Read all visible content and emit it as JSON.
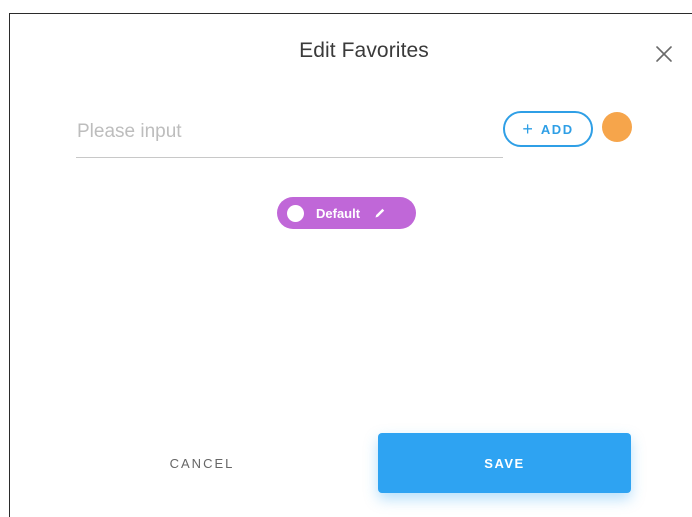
{
  "dialog": {
    "title": "Edit Favorites",
    "close_icon": "close-icon"
  },
  "form": {
    "input": {
      "value": "",
      "placeholder": "Please input"
    },
    "add_button": {
      "icon": "plus-icon",
      "plus_glyph": "+",
      "label": "ADD"
    },
    "selected_color": "#f6a54b"
  },
  "favorites": [
    {
      "label": "Default",
      "color": "#c067d8",
      "enabled": true,
      "edit_icon": "pencil-icon"
    }
  ],
  "footer": {
    "cancel_label": "CANCEL",
    "save_label": "SAVE"
  },
  "colors": {
    "primary": "#2ea3f2",
    "accent_orange": "#f6a54b",
    "chip_purple": "#c067d8"
  }
}
